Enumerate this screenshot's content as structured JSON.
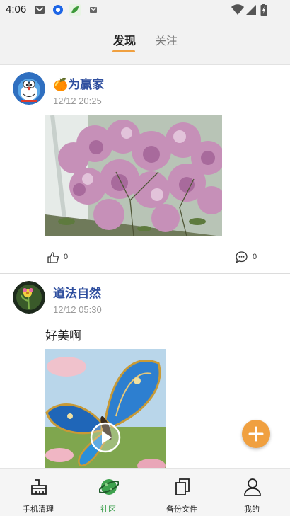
{
  "status_bar": {
    "time": "4:06"
  },
  "header": {
    "tabs": [
      {
        "label": "发现",
        "active": true
      },
      {
        "label": "关注",
        "active": false
      }
    ],
    "accent_color": "#f0a040"
  },
  "posts": [
    {
      "username": "🍊为赢家",
      "time": "12/12 20:25",
      "text": "",
      "image": "lilac-flowers-photo",
      "likes": "0",
      "comments": "0"
    },
    {
      "username": "道法自然",
      "time": "12/12 05:30",
      "text": "好美啊",
      "image": "butterfly-video-thumbnail"
    }
  ],
  "fab": {
    "icon": "plus-icon"
  },
  "bottom_nav": {
    "items": [
      {
        "label": "手机清理",
        "icon": "broom-icon"
      },
      {
        "label": "社区",
        "icon": "planet-icon",
        "active": true
      },
      {
        "label": "备份文件",
        "icon": "copy-icon"
      },
      {
        "label": "我的",
        "icon": "person-icon"
      }
    ],
    "active_color": "#3a9e4b"
  }
}
